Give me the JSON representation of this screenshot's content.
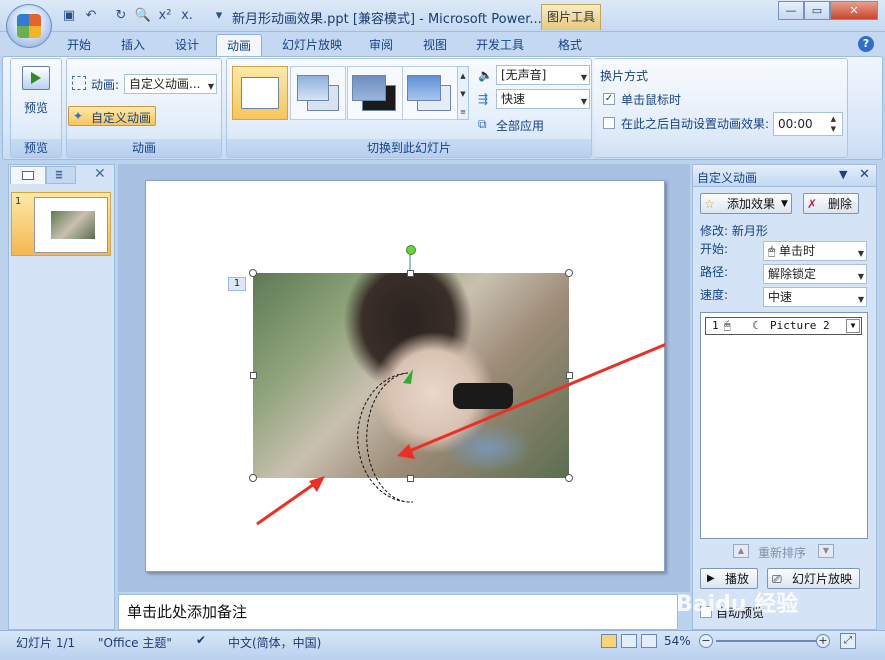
{
  "title": "新月形动画效果.ppt [兼容模式] - Microsoft Power...",
  "contextual_tab": "图片工具",
  "tabs": [
    "开始",
    "插入",
    "设计",
    "动画",
    "幻灯片放映",
    "审阅",
    "视图",
    "开发工具",
    "格式"
  ],
  "ribbon": {
    "preview_group": {
      "button": "预览",
      "label": "预览"
    },
    "animation_group": {
      "anim_label": "动画:",
      "anim_value": "自定义动画...",
      "custom_button": "自定义动画",
      "label": "动画"
    },
    "transition_group": {
      "sound_value": "[无声音]",
      "speed_value": "快速",
      "apply_all": "全部应用",
      "label": "切换到此幻灯片"
    },
    "advance_group": {
      "title": "换片方式",
      "on_click": "单击鼠标时",
      "on_click_checked": true,
      "auto_label": "在此之后自动设置动画效果:",
      "auto_checked": false,
      "auto_time": "00:00"
    }
  },
  "left_panel": {
    "slide_number": "1"
  },
  "slide": {
    "anim_tag": "1"
  },
  "notes_placeholder": "单击此处添加备注",
  "task_pane": {
    "title": "自定义动画",
    "add_effect": "添加效果",
    "remove": "删除",
    "modify_label": "修改: 新月形",
    "start_label": "开始:",
    "start_value": "单击时",
    "path_label": "路径:",
    "path_value": "解除锁定",
    "speed_label": "速度:",
    "speed_value": "中速",
    "list_item": {
      "index": "1",
      "name": "Picture 2"
    },
    "reorder": "重新排序",
    "play": "播放",
    "slideshow": "幻灯片放映",
    "autopreview": "自动预览"
  },
  "status": {
    "slide": "幻灯片 1/1",
    "theme": "\"Office 主题\"",
    "language": "中文(简体，中国)",
    "zoom": "54%"
  },
  "watermark": "Baidu 经验"
}
